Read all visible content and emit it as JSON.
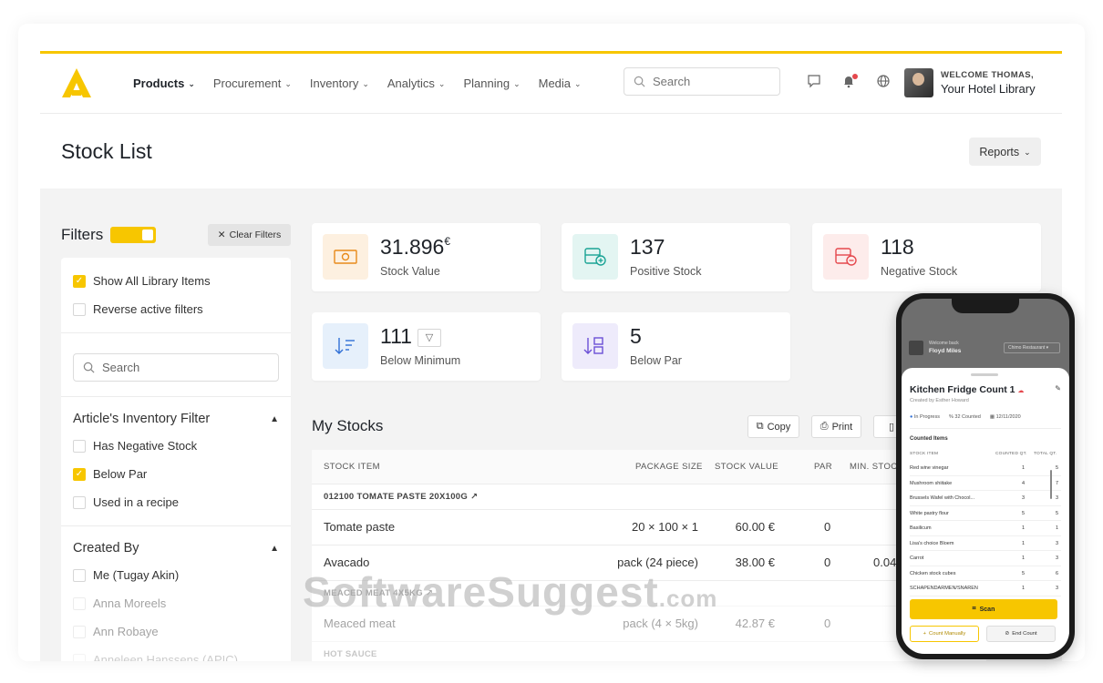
{
  "nav": {
    "menu": [
      {
        "label": "Products"
      },
      {
        "label": "Procurement"
      },
      {
        "label": "Inventory"
      },
      {
        "label": "Analytics"
      },
      {
        "label": "Planning"
      },
      {
        "label": "Media"
      }
    ],
    "search_placeholder": "Search",
    "welcome": "WELCOME THOMAS,",
    "library": "Your Hotel Library",
    "accent": "#f7c600"
  },
  "page": {
    "title": "Stock List",
    "reports_label": "Reports"
  },
  "filters": {
    "title": "Filters",
    "clear_label": "Clear Filters",
    "show_all": "Show All Library Items",
    "reverse": "Reverse active filters",
    "search_placeholder": "Search",
    "inventory_filter_title": "Article's Inventory Filter",
    "inventory_options": [
      "Has Negative Stock",
      "Below Par",
      "Used in a recipe"
    ],
    "created_by_title": "Created By",
    "created_by_options": [
      "Me (Tugay Akin)",
      "Anna Moreels",
      "Ann Robaye",
      "Anneleen Hanssens (APIC)"
    ]
  },
  "stats": {
    "stock_value": {
      "value": "31.896",
      "unit": "€",
      "label": "Stock Value"
    },
    "positive": {
      "value": "137",
      "label": "Positive Stock"
    },
    "negative": {
      "value": "118",
      "label": "Negative Stock"
    },
    "below_min": {
      "value": "111",
      "label": "Below Minimum"
    },
    "below_par": {
      "value": "5",
      "label": "Below Par"
    }
  },
  "stocks": {
    "title": "My Stocks",
    "copy_label": "Copy",
    "print_label": "Print",
    "columns": [
      "STOCK ITEM",
      "PACKAGE SIZE",
      "STOCK VALUE",
      "PAR",
      "MIN. STOCK"
    ],
    "group1": "012100 TOMATE PASTE 20X100G",
    "group2": "MEACED MEAT 4X5KG",
    "group3": "HOT SAUCE",
    "rows": [
      {
        "item": "Tomate paste",
        "package": "20 × 100 × 1",
        "value": "60.00 €",
        "par": "0",
        "min": ""
      },
      {
        "item": "Avacado",
        "package": "pack (24 piece)",
        "value": "38.00 €",
        "par": "0",
        "min": "0.04"
      },
      {
        "item": "Meaced meat",
        "package": "pack (4 × 5kg)",
        "value": "42.87 €",
        "par": "0",
        "min": ""
      }
    ]
  },
  "watermark": {
    "main": "SoftwareSuggest",
    "suffix": ".com"
  },
  "phone": {
    "welcome": "Welcome back",
    "user": "Floyd Miles",
    "venue": "Chimo Restaurant",
    "count_title": "Kitchen Fridge Count 1",
    "created_by": "Created by Esther Howard",
    "status": "In Progress",
    "counted": "32 Counted",
    "date": "12/11/2020",
    "section": "Counted Items",
    "headers": [
      "STOCK ITEM",
      "COUNTED QT.",
      "TOTAL QT."
    ],
    "items": [
      {
        "name": "Red wine vinegar",
        "counted": "1",
        "total": "5"
      },
      {
        "name": "Mushroom shiitake",
        "counted": "4",
        "total": "7"
      },
      {
        "name": "Brussels Wafel with Chocol...",
        "counted": "3",
        "total": "3"
      },
      {
        "name": "White pastry flour",
        "counted": "5",
        "total": "5"
      },
      {
        "name": "Basilicum",
        "counted": "1",
        "total": "1"
      },
      {
        "name": "Lisa's choice Bloem",
        "counted": "1",
        "total": "3"
      },
      {
        "name": "Carrot",
        "counted": "1",
        "total": "3"
      },
      {
        "name": "Chicken stock cubes",
        "counted": "5",
        "total": "6"
      },
      {
        "name": "SCHAPENDARMEN/SNAREN",
        "counted": "1",
        "total": "3"
      }
    ],
    "scan_label": "Scan",
    "count_manually": "Count Manually",
    "end_count": "End Count"
  }
}
